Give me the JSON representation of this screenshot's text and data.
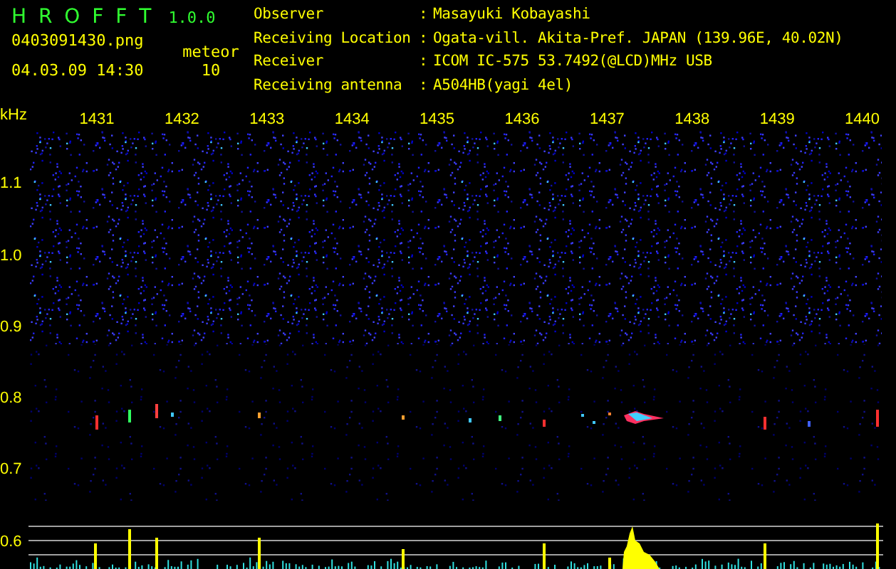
{
  "app": {
    "title": "H R O F F T",
    "version": "1.0.0",
    "file_name": "0403091430.png",
    "date_time": "04.03.09 14:30",
    "counter_label": "meteor",
    "counter_value": "10"
  },
  "station_info": [
    {
      "label": "Observer",
      "separator": ":",
      "value": "Masayuki Kobayashi"
    },
    {
      "label": "Receiving Location",
      "separator": ":",
      "value": "Ogata-vill. Akita-Pref. JAPAN (139.96E, 40.02N)"
    },
    {
      "label": "Receiver",
      "separator": ":",
      "value": "ICOM IC-575 53.7492(@LCD)MHz USB"
    },
    {
      "label": "Receiving antenna",
      "separator": ":",
      "value": "A504HB(yagi 4el)"
    }
  ],
  "spectrogram": {
    "unit_label": "kHz",
    "x_labels": [
      "1431",
      "1432",
      "1433",
      "1434",
      "1435",
      "1436",
      "1437",
      "1438",
      "1439",
      "1440"
    ],
    "y_labels": [
      "1.1",
      "1.0",
      "0.9",
      "0.8",
      "0.7",
      "0.6"
    ]
  }
}
